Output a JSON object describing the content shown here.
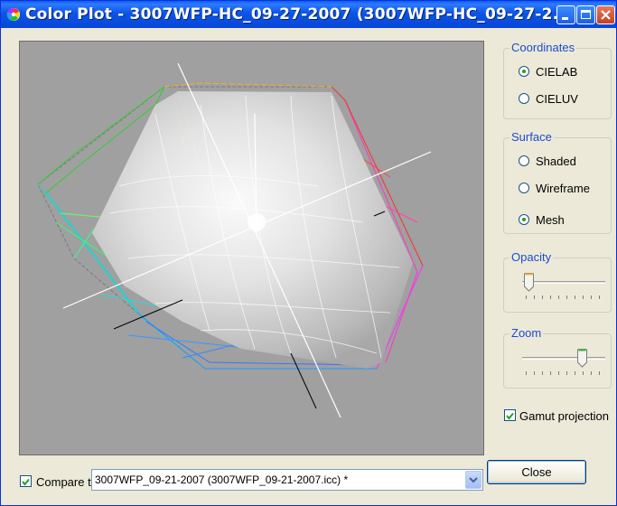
{
  "window": {
    "title": "Color Plot - 3007WFP-HC_09-27-2007 (3007WFP-HC_09-27-2..."
  },
  "coordinates": {
    "label": "Coordinates",
    "options": [
      {
        "label": "CIELAB",
        "selected": true
      },
      {
        "label": "CIELUV",
        "selected": false
      }
    ]
  },
  "surface": {
    "label": "Surface",
    "options": [
      {
        "label": "Shaded",
        "selected": false
      },
      {
        "label": "Wireframe",
        "selected": false
      },
      {
        "label": "Mesh",
        "selected": true
      }
    ]
  },
  "opacity": {
    "label": "Opacity",
    "value_fraction": 0.02
  },
  "zoom": {
    "label": "Zoom",
    "value_fraction": 0.75
  },
  "gamut_projection": {
    "label": "Gamut projection",
    "checked": true
  },
  "compare": {
    "label": "Compare t",
    "checked": true,
    "selected_profile": "3007WFP_09-21-2007 (3007WFP_09-21-2007.icc) *"
  },
  "close_button": {
    "label": "Close"
  },
  "colors": {
    "titlebar": "#0b55e6",
    "plot_background": "#a0a0a0",
    "group_title": "#1c4bd0"
  }
}
